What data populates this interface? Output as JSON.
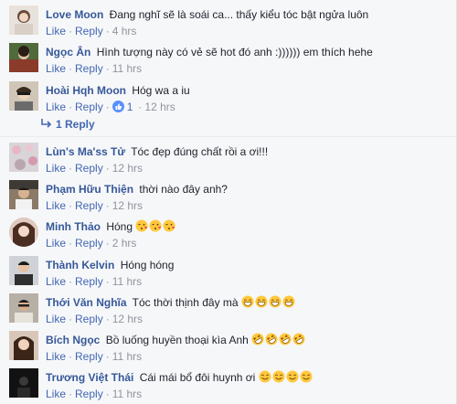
{
  "comments": [
    {
      "author": "Love Moon",
      "text": "Đang nghĩ sẽ là soái ca... thấy kiểu tóc bật ngửa luôn",
      "like": "Like",
      "reply": "Reply",
      "time": "4 hrs",
      "emojis": []
    },
    {
      "author": "Ngọc Ân",
      "text": "Hình tượng này có vẻ sẽ hot đó anh :)))))) em thích hehe",
      "like": "Like",
      "reply": "Reply",
      "time": "11 hrs",
      "emojis": []
    },
    {
      "author": "Hoài Hqh Moon",
      "text": "Hóg wa a iu",
      "like": "Like",
      "reply": "Reply",
      "time": "12 hrs",
      "like_count": "1",
      "emojis": []
    },
    {
      "author": "Lùn's Ma'ss Tử",
      "text": "Tóc đẹp đúng chất rồi a ơi!!!",
      "like": "Like",
      "reply": "Reply",
      "time": "12 hrs",
      "emojis": []
    },
    {
      "author": "Phạm Hữu Thiện",
      "text": "thời nào đây anh?",
      "like": "Like",
      "reply": "Reply",
      "time": "12 hrs",
      "emojis": []
    },
    {
      "author": "Minh Thảo",
      "text": "Hóng",
      "like": "Like",
      "reply": "Reply",
      "time": "2 hrs",
      "emojis": [
        "kiss-heart-emoji",
        "kiss-heart-emoji",
        "kiss-heart-emoji"
      ]
    },
    {
      "author": "Thành Kelvin",
      "text": "Hóng hóng",
      "like": "Like",
      "reply": "Reply",
      "time": "11 hrs",
      "emojis": []
    },
    {
      "author": "Thới Văn Nghĩa",
      "text": "Tóc thời thịnh đây mà",
      "like": "Like",
      "reply": "Reply",
      "time": "12 hrs",
      "emojis": [
        "grin-emoji",
        "grin-emoji",
        "grin-emoji",
        "grin-emoji"
      ]
    },
    {
      "author": "Bích Ngọc",
      "text": "Bồ luống huyền thoại kìa Anh",
      "like": "Like",
      "reply": "Reply",
      "time": "11 hrs",
      "emojis": [
        "rofl-emoji",
        "rofl-emoji",
        "rofl-emoji",
        "rofl-emoji"
      ]
    },
    {
      "author": "Trương Việt Thái",
      "text": "Cái mái bổ đôi huynh ơi",
      "like": "Like",
      "reply": "Reply",
      "time": "11 hrs",
      "emojis": [
        "smile-emoji",
        "smile-emoji",
        "smile-emoji",
        "smile-emoji"
      ]
    }
  ],
  "reply_link": "1 Reply",
  "colors": {
    "author": "#365899",
    "link": "#4267b2",
    "meta": "#90949c",
    "background": "#f6f7f9"
  }
}
